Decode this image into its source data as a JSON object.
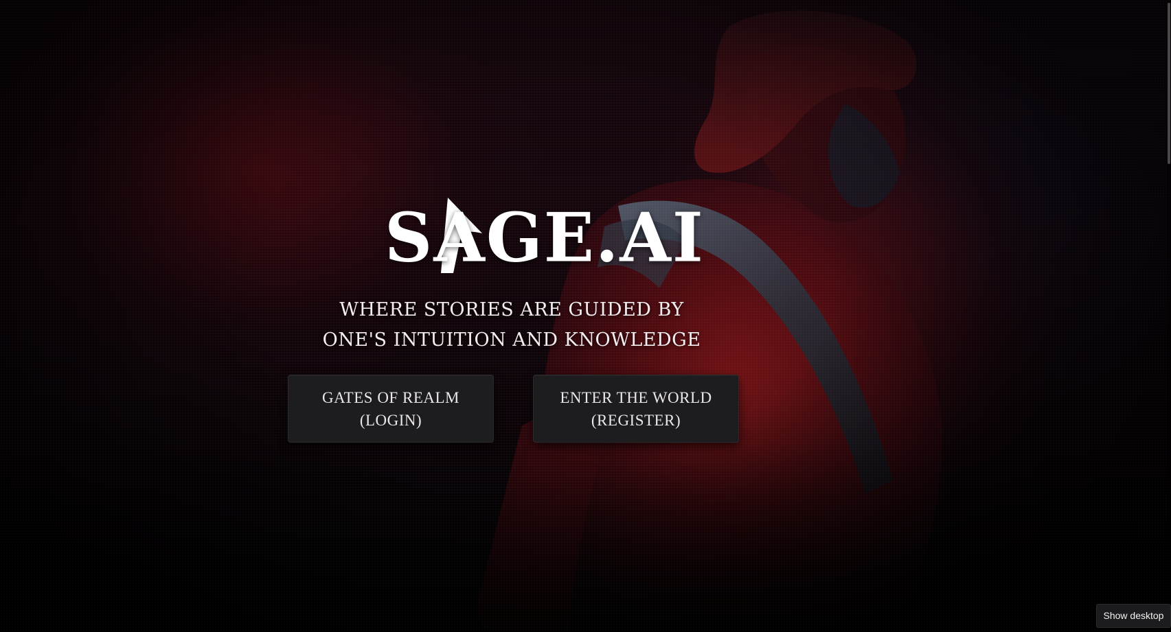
{
  "brand": {
    "logo_text": "SAGE.AI"
  },
  "hero": {
    "tagline_line1": "WHERE STORIES ARE GUIDED BY",
    "tagline_line2": "ONE'S INTUITION AND KNOWLEDGE"
  },
  "buttons": {
    "login_line1": "GATES OF REALM",
    "login_line2": "(LOGIN)",
    "register_line1": "ENTER THE WORLD",
    "register_line2": "(REGISTER)"
  },
  "system": {
    "show_desktop_label": "Show desktop"
  },
  "colors": {
    "background_accent": "#8c0f14",
    "button_bg": "#1d1c1f",
    "text": "#ffffff"
  },
  "icons": {
    "logo_hat": "wizard-hat-icon"
  }
}
